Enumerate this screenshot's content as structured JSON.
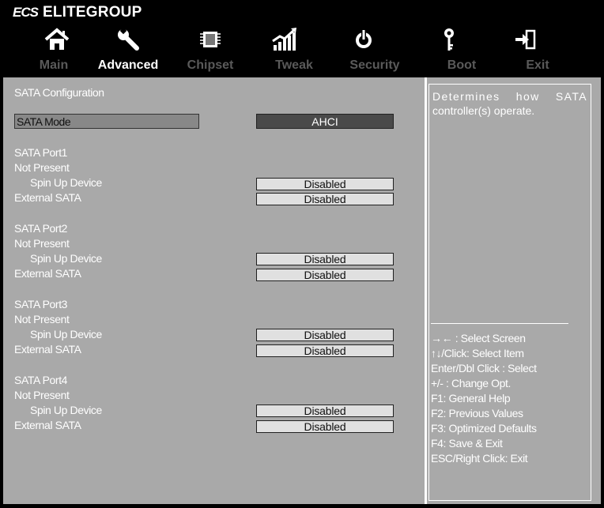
{
  "brand": {
    "logo": "ECS",
    "name": "ELITEGROUP"
  },
  "icons": [
    "home-icon",
    "wrench-icon",
    "chip-icon",
    "bar-chart-icon",
    "power-icon",
    "key-icon",
    "exit-icon"
  ],
  "tabs": [
    {
      "label": "Main"
    },
    {
      "label": "Advanced"
    },
    {
      "label": "Chipset"
    },
    {
      "label": "Tweak"
    },
    {
      "label": "Security"
    },
    {
      "label": "Boot"
    },
    {
      "label": "Exit"
    }
  ],
  "active_tab": "Advanced",
  "content": {
    "heading": "SATA Configuration",
    "sata_mode": {
      "label": "SATA Mode",
      "value": "AHCI"
    },
    "ports": [
      {
        "name": "SATA Port1",
        "status": "Not Present",
        "spin_label": "Spin Up Device",
        "spin_value": "Disabled",
        "ext_label": "External SATA",
        "ext_value": "Disabled"
      },
      {
        "name": "SATA Port2",
        "status": "Not Present",
        "spin_label": "Spin Up Device",
        "spin_value": "Disabled",
        "ext_label": "External SATA",
        "ext_value": "Disabled"
      },
      {
        "name": "SATA Port3",
        "status": "Not Present",
        "spin_label": "Spin Up Device",
        "spin_value": "Disabled",
        "ext_label": "External SATA",
        "ext_value": "Disabled"
      },
      {
        "name": "SATA Port4",
        "status": "Not Present",
        "spin_label": "Spin Up Device",
        "spin_value": "Disabled",
        "ext_label": "External SATA",
        "ext_value": "Disabled"
      }
    ]
  },
  "help": {
    "desc_words": [
      "Determines",
      "how",
      "SATA"
    ],
    "desc_line2": "controller(s) operate.",
    "keys": [
      "→← : Select Screen",
      "↑↓/Click: Select Item",
      "Enter/Dbl Click : Select",
      "+/- : Change Opt.",
      "F1: General Help",
      "F2: Previous Values",
      "F3: Optimized Defaults",
      "F4: Save & Exit",
      "ESC/Right Click: Exit"
    ]
  },
  "colors": {
    "panel": "#a9a9a9",
    "frame": "#000000",
    "inactive_tab": "#5a5a5a",
    "value_box": "#e0e0e0",
    "mode_value_bg": "#4a4a4a"
  }
}
